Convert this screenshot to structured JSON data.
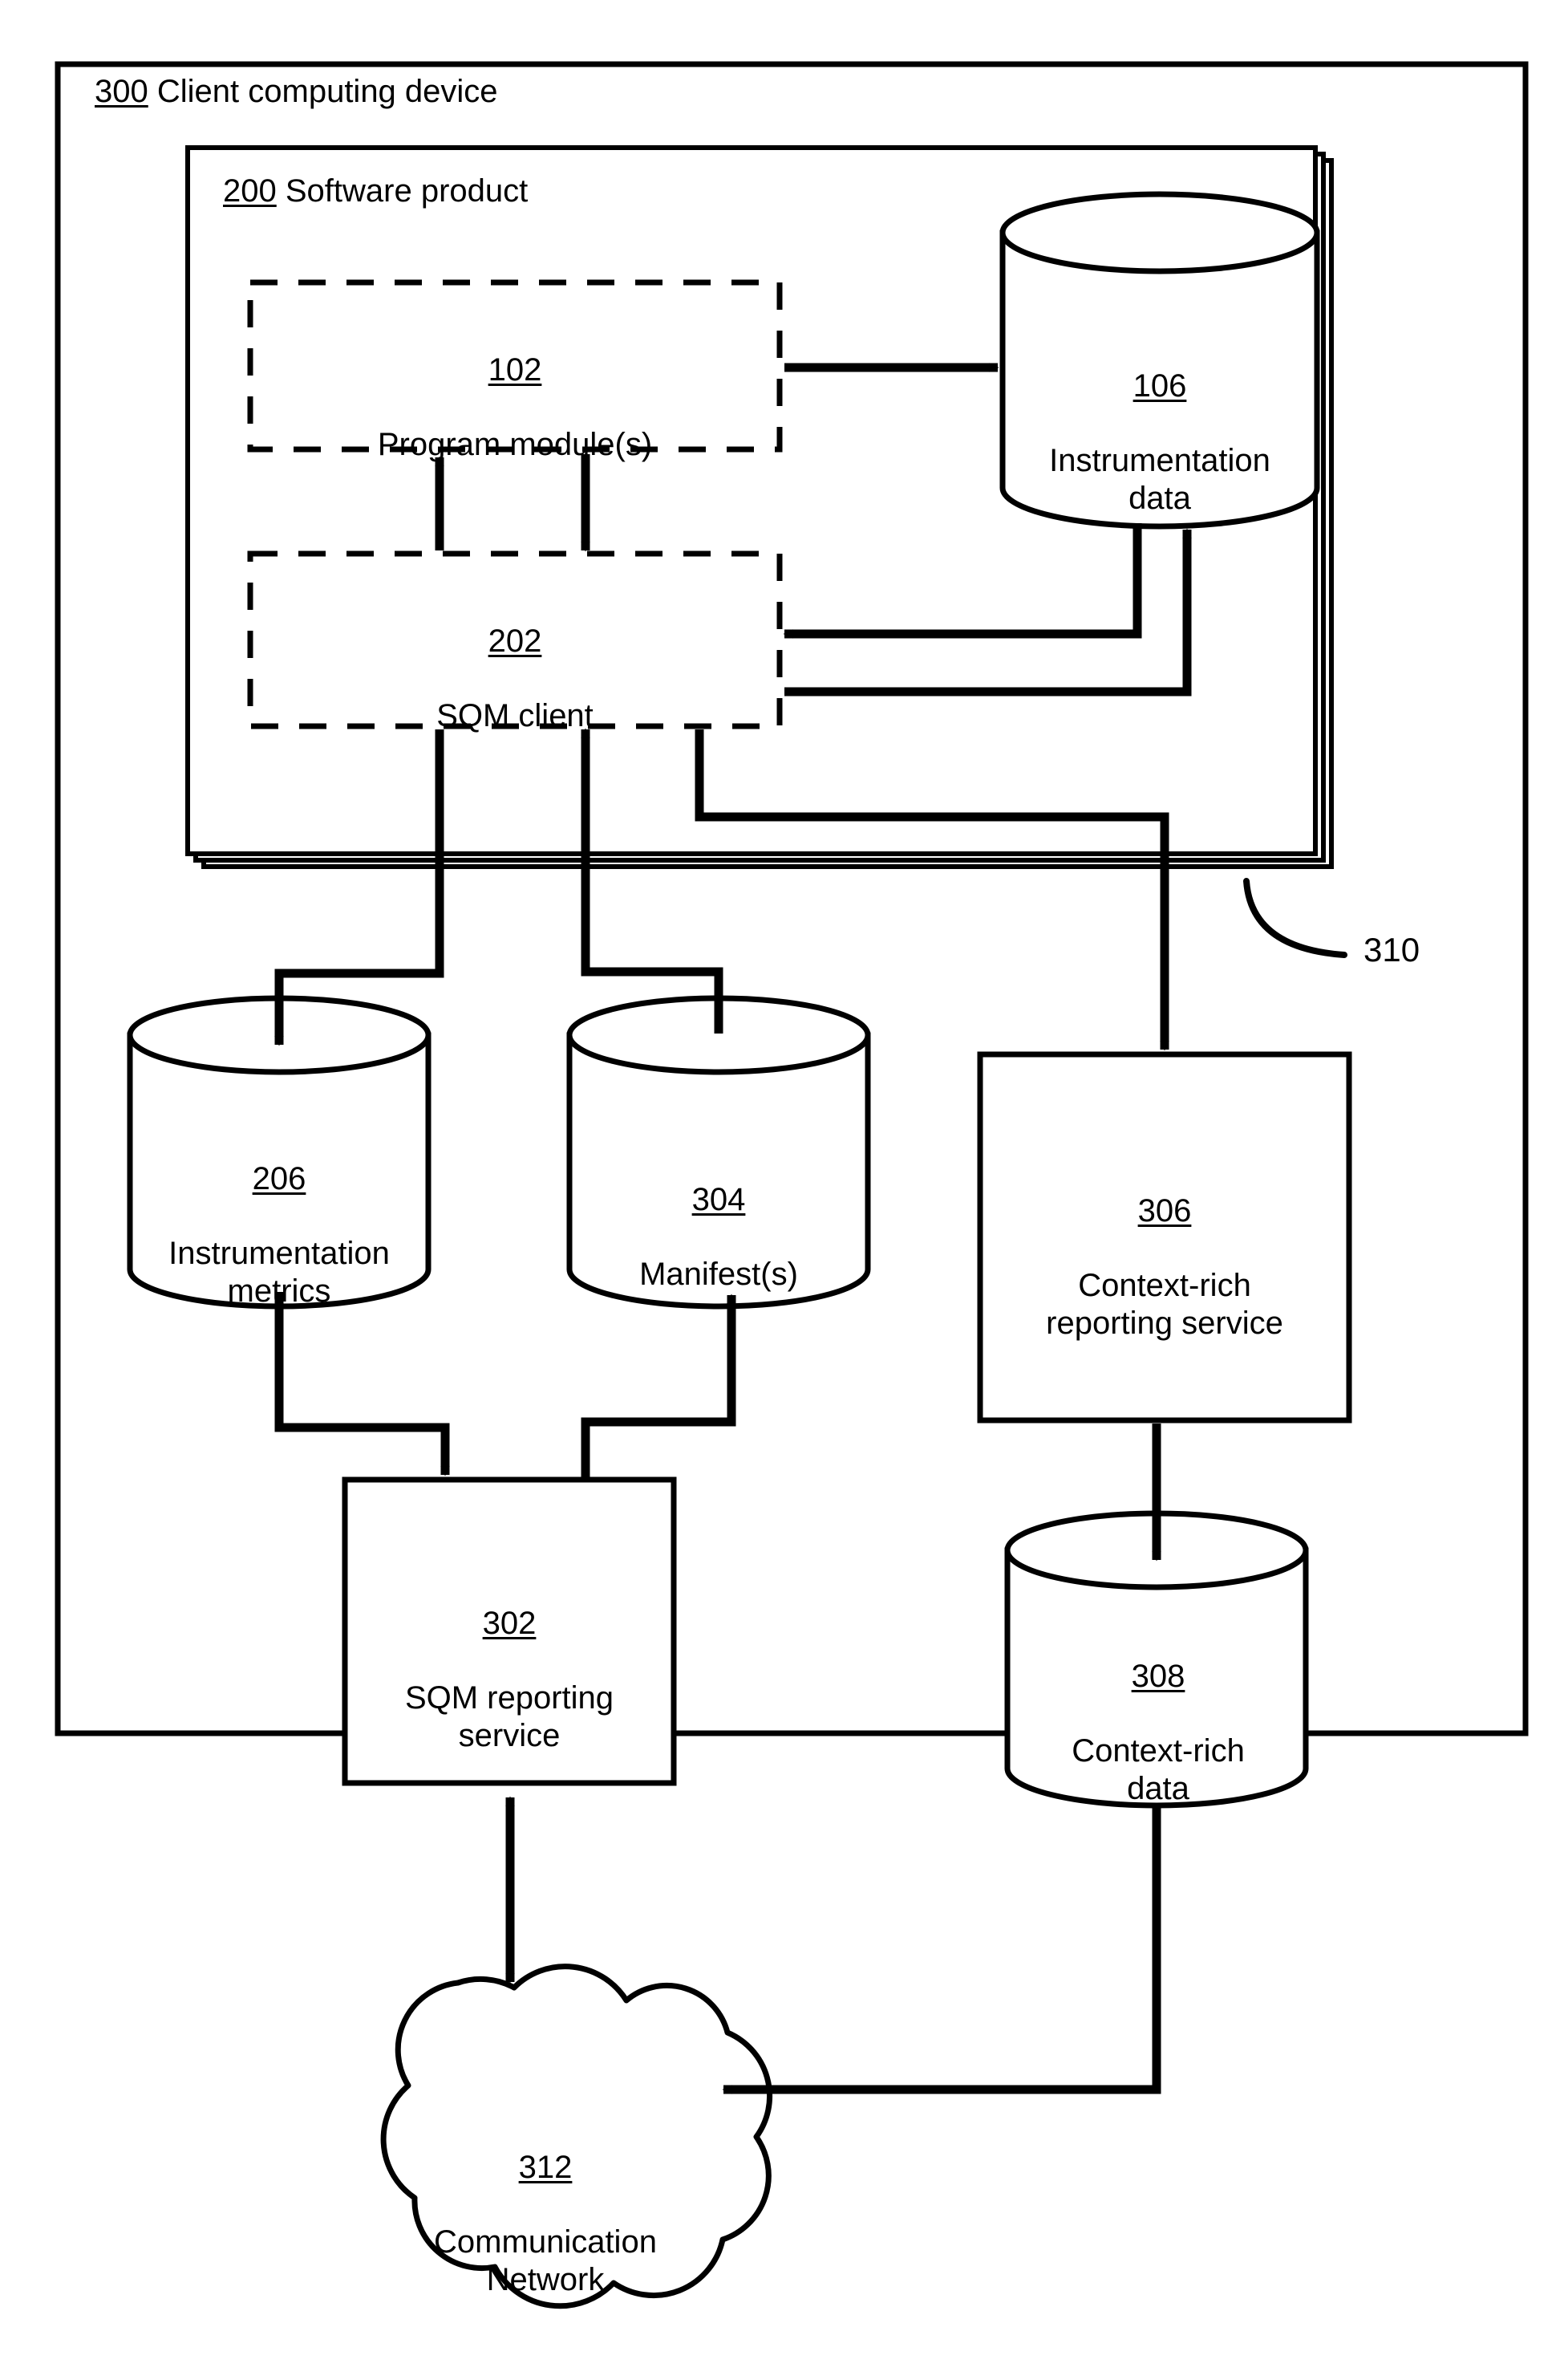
{
  "figure": {
    "outer_container": {
      "ref": "300",
      "label": "Client computing device"
    },
    "software_product": {
      "ref": "200",
      "label": "Software product",
      "stack_note_ref": "310"
    },
    "nodes": [
      {
        "id": "program-modules",
        "ref": "102",
        "label": "Program module(s)",
        "shape": "dashed-box"
      },
      {
        "id": "instrumentation-data",
        "ref": "106",
        "label": "Instrumentation\ndata",
        "shape": "cylinder"
      },
      {
        "id": "sqm-client",
        "ref": "202",
        "label": "SQM client",
        "shape": "dashed-box"
      },
      {
        "id": "instrumentation-metrics",
        "ref": "206",
        "label": "Instrumentation\nmetrics",
        "shape": "cylinder"
      },
      {
        "id": "manifests",
        "ref": "304",
        "label": "Manifest(s)",
        "shape": "cylinder"
      },
      {
        "id": "context-rich-reporting-service",
        "ref": "306",
        "label": "Context-rich\nreporting service",
        "shape": "box"
      },
      {
        "id": "sqm-reporting-service",
        "ref": "302",
        "label": "SQM reporting\nservice",
        "shape": "box"
      },
      {
        "id": "context-rich-data",
        "ref": "308",
        "label": "Context-rich\ndata",
        "shape": "cylinder"
      },
      {
        "id": "communication-network",
        "ref": "312",
        "label": "Communication\nNetwork",
        "shape": "cloud"
      }
    ],
    "stack_callout": {
      "ref": "310"
    },
    "connections": [
      {
        "from": "102",
        "to": "106",
        "type": "arrow"
      },
      {
        "from": "102",
        "to": "202",
        "type": "arrow"
      },
      {
        "from": "202",
        "to": "102",
        "type": "arrow"
      },
      {
        "from": "106",
        "to": "202",
        "type": "arrow"
      },
      {
        "from": "202",
        "to": "106",
        "type": "arrow"
      },
      {
        "from": "202",
        "to": "206",
        "type": "arrow"
      },
      {
        "from": "304",
        "to": "202",
        "type": "arrow"
      },
      {
        "from": "202",
        "to": "306",
        "type": "arrow"
      },
      {
        "from": "206",
        "to": "302",
        "type": "arrow"
      },
      {
        "from": "302",
        "to": "304",
        "type": "arrow"
      },
      {
        "from": "306",
        "to": "308",
        "type": "arrow"
      },
      {
        "from": "302",
        "to": "312",
        "type": "double-arrow"
      },
      {
        "from": "308",
        "to": "312",
        "type": "arrow"
      }
    ],
    "colors": {
      "stroke": "#000000",
      "background": "#ffffff"
    }
  }
}
